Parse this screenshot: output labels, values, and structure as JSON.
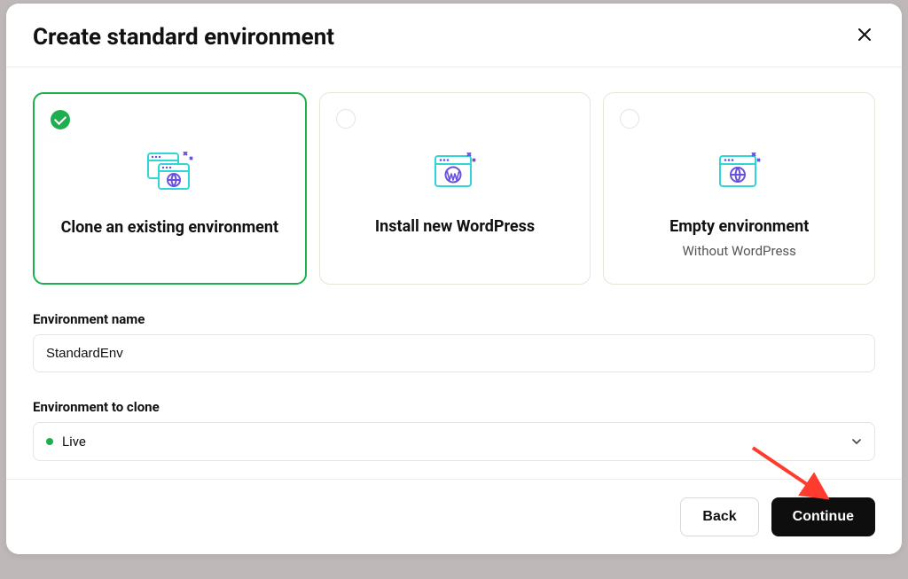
{
  "header": {
    "title": "Create standard environment"
  },
  "options": {
    "clone": {
      "title": "Clone an existing environment",
      "selected": true
    },
    "install": {
      "title": "Install new WordPress",
      "selected": false
    },
    "empty": {
      "title": "Empty environment",
      "subtitle": "Without WordPress",
      "selected": false
    }
  },
  "form": {
    "env_name_label": "Environment name",
    "env_name_value": "StandardEnv",
    "clone_label": "Environment to clone",
    "clone_selected": "Live"
  },
  "footer": {
    "back_label": "Back",
    "continue_label": "Continue"
  }
}
